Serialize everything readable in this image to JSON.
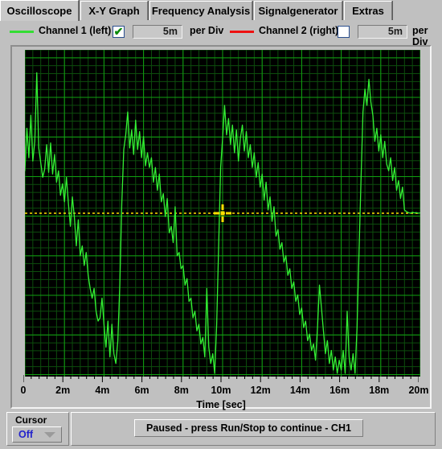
{
  "window": {
    "title": "Oscilloscope"
  },
  "tabs": [
    {
      "label": "Oscilloscope",
      "active": true
    },
    {
      "label": "X-Y Graph",
      "active": false
    },
    {
      "label": "Frequency Analysis",
      "active": false
    },
    {
      "label": "Signalgenerator",
      "active": false
    },
    {
      "label": "Extras",
      "active": false
    }
  ],
  "controls": {
    "channel1": {
      "label": "Channel 1 (left)",
      "color": "#33dd33",
      "enabled": true,
      "checkmark": "✔",
      "value": "5m",
      "unit_label": "per Div"
    },
    "channel2": {
      "label": "Channel 2 (right)",
      "color": "#ee1111",
      "enabled": false,
      "checkmark": "",
      "value": "5m",
      "unit_label": "per Div"
    }
  },
  "plot": {
    "background": "#000000",
    "grid_minor_color": "#0d4d0d",
    "grid_major_color": "#10a010",
    "trace_color": "#33f033",
    "cursor_color": "#ffe000",
    "axis_title": "Time [sec]",
    "x_ticks": [
      "0",
      "2m",
      "4m",
      "6m",
      "8m",
      "10m",
      "12m",
      "14m",
      "16m",
      "18m",
      "20m"
    ]
  },
  "bottom": {
    "cursor_label": "Cursor",
    "cursor_value": "Off",
    "status_message": "Paused - press Run/Stop to continue - CH1"
  },
  "chart_data": {
    "type": "line",
    "title": "Oscilloscope Channel 1 trace",
    "xlabel": "Time [sec]",
    "ylabel": "",
    "xlim": [
      0,
      0.02
    ],
    "ylim": [
      -5,
      5
    ],
    "grid": true,
    "legend_position": "top",
    "volts_per_div": "5m",
    "x_tick_values": [
      0,
      0.002,
      0.004,
      0.006,
      0.008,
      0.01,
      0.012,
      0.014,
      0.016,
      0.018,
      0.02
    ],
    "x_tick_labels": [
      "0",
      "2m",
      "4m",
      "6m",
      "8m",
      "10m",
      "12m",
      "14m",
      "16m",
      "18m",
      "20m"
    ],
    "cursor": {
      "x": 0.01,
      "y": 0.0,
      "style": "crosshair-dashed"
    },
    "series": [
      {
        "name": "Channel 1 (left)",
        "color": "#33f033",
        "x": [
          0.0,
          0.0001,
          0.0002,
          0.0003,
          0.0004,
          0.0005,
          0.0006,
          0.0007,
          0.0008,
          0.0009,
          0.001,
          0.0011,
          0.0012,
          0.0013,
          0.0014,
          0.0015,
          0.0016,
          0.0017,
          0.0018,
          0.0019,
          0.002,
          0.0021,
          0.0022,
          0.0023,
          0.0024,
          0.0025,
          0.0026,
          0.0027,
          0.0028,
          0.0029,
          0.003,
          0.0031,
          0.0032,
          0.0033,
          0.0034,
          0.0035,
          0.0036,
          0.0037,
          0.0038,
          0.0039,
          0.004,
          0.0041,
          0.0042,
          0.0043,
          0.0044,
          0.0045,
          0.0046,
          0.0047,
          0.0048,
          0.0049,
          0.005,
          0.0051,
          0.0052,
          0.0053,
          0.0054,
          0.0055,
          0.0056,
          0.0057,
          0.0058,
          0.0059,
          0.006,
          0.0061,
          0.0062,
          0.0063,
          0.0064,
          0.0065,
          0.0066,
          0.0067,
          0.0068,
          0.0069,
          0.007,
          0.0071,
          0.0072,
          0.0073,
          0.0074,
          0.0075,
          0.0076,
          0.0077,
          0.0078,
          0.0079,
          0.008,
          0.0081,
          0.0082,
          0.0083,
          0.0084,
          0.0085,
          0.0086,
          0.0087,
          0.0088,
          0.0089,
          0.009,
          0.0091,
          0.0092,
          0.0093,
          0.0094,
          0.0095,
          0.0096,
          0.0097,
          0.0098,
          0.0099,
          0.01,
          0.0101,
          0.0102,
          0.0103,
          0.0104,
          0.0105,
          0.0106,
          0.0107,
          0.0108,
          0.0109,
          0.011,
          0.0111,
          0.0112,
          0.0113,
          0.0114,
          0.0115,
          0.0116,
          0.0117,
          0.0118,
          0.0119,
          0.012,
          0.0121,
          0.0122,
          0.0123,
          0.0124,
          0.0125,
          0.0126,
          0.0127,
          0.0128,
          0.0129,
          0.013,
          0.0131,
          0.0132,
          0.0133,
          0.0134,
          0.0135,
          0.0136,
          0.0137,
          0.0138,
          0.0139,
          0.014,
          0.0141,
          0.0142,
          0.0143,
          0.0144,
          0.0145,
          0.0146,
          0.0147,
          0.0148,
          0.0149,
          0.015,
          0.0151,
          0.0152,
          0.0153,
          0.0154,
          0.0155,
          0.0156,
          0.0157,
          0.0158,
          0.0159,
          0.016,
          0.0161,
          0.0162,
          0.0163,
          0.0164,
          0.0165,
          0.0166,
          0.0167,
          0.0168,
          0.0169,
          0.017,
          0.0171,
          0.0172,
          0.0173,
          0.0174,
          0.0175,
          0.0176,
          0.0177,
          0.0178,
          0.0179,
          0.018,
          0.0181,
          0.0182,
          0.0183,
          0.0184,
          0.0185,
          0.0186,
          0.0187,
          0.0188,
          0.0189,
          0.019,
          0.0191,
          0.0192,
          0.0193,
          0.0194,
          0.0195,
          0.0196,
          0.0197,
          0.0198,
          0.0199,
          0.02
        ],
        "y": [
          1.3,
          2.6,
          1.7,
          3.0,
          1.6,
          2.2,
          4.3,
          2.0,
          1.55,
          1.1,
          1.35,
          2.1,
          1.25,
          2.15,
          1.2,
          1.8,
          0.95,
          1.3,
          0.55,
          0.9,
          0.35,
          1.1,
          0.3,
          -0.4,
          0.5,
          -0.1,
          -1.0,
          -0.2,
          -1.3,
          -1.0,
          -1.6,
          -1.2,
          -1.9,
          -2.3,
          -2.6,
          -2.3,
          -3.0,
          -3.3,
          -3.2,
          -2.6,
          -3.4,
          -4.1,
          -3.3,
          -4.4,
          -3.4,
          -4.3,
          -4.6,
          -3.9,
          -2.2,
          0.3,
          1.95,
          2.4,
          3.1,
          2.0,
          2.55,
          1.8,
          2.85,
          1.95,
          2.5,
          1.7,
          2.35,
          1.45,
          1.85,
          1.4,
          1.7,
          0.95,
          1.4,
          0.7,
          1.2,
          0.35,
          0.6,
          -0.1,
          0.45,
          -0.6,
          -0.4,
          -0.9,
          0.2,
          -1.3,
          -1.2,
          -1.7,
          -1.6,
          -2.2,
          -2.0,
          -2.7,
          -2.6,
          -3.2,
          -3.0,
          -3.6,
          -3.4,
          -4.0,
          -3.8,
          -4.4,
          -2.3,
          -4.1,
          -4.6,
          -4.3,
          -4.9,
          -3.4,
          -1.0,
          1.4,
          2.3,
          3.3,
          2.4,
          2.9,
          2.1,
          2.7,
          1.85,
          2.55,
          1.6,
          2.3,
          2.7,
          1.9,
          2.5,
          1.7,
          2.1,
          1.4,
          1.85,
          1.1,
          1.55,
          0.8,
          1.2,
          0.4,
          0.95,
          0.1,
          0.5,
          -0.25,
          0.2,
          -0.7,
          -0.5,
          -1.1,
          -0.9,
          -1.5,
          -1.3,
          -1.9,
          -1.7,
          -2.3,
          -2.1,
          -2.7,
          -2.5,
          -3.1,
          -2.9,
          -3.5,
          -3.3,
          -3.9,
          -3.7,
          -4.2,
          -4.0,
          -4.5,
          -3.5,
          -2.2,
          -2.9,
          -3.6,
          -4.3,
          -3.9,
          -4.6,
          -4.2,
          -4.8,
          -4.4,
          -4.9,
          -4.5,
          -4.8,
          -4.2,
          -4.9,
          -3.0,
          -4.4,
          -4.8,
          -4.3,
          -4.9,
          -3.5,
          -1.2,
          1.0,
          3.1,
          3.8,
          3.3,
          4.1,
          3.4,
          3.0,
          2.2,
          2.6,
          1.9,
          2.4,
          1.7,
          2.2,
          1.5,
          1.3,
          1.7,
          1.0,
          1.4,
          0.7,
          1.0,
          0.45,
          0.8,
          0.1,
          0.05,
          0.02,
          0.0,
          0.03,
          0.01,
          0.02,
          0.0,
          0.01
        ]
      }
    ]
  }
}
